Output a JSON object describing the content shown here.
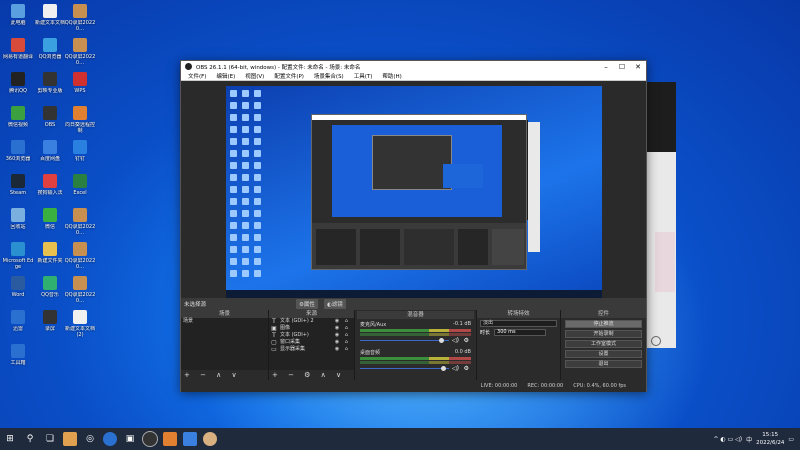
{
  "desktop": {
    "icons": [
      {
        "label": "此电脑",
        "color": "#5aa0e0"
      },
      {
        "label": "新建文本文档",
        "color": "#f0f0f0"
      },
      {
        "label": "QQ录屏20220…",
        "color": "#c89050"
      },
      {
        "label": "网易有道翻译",
        "color": "#d84a3a"
      },
      {
        "label": "QQ浏览器",
        "color": "#3aa0e0"
      },
      {
        "label": "QQ录屏20220…",
        "color": "#c89050"
      },
      {
        "label": "腾讯QQ",
        "color": "#222"
      },
      {
        "label": "剪映专业版",
        "color": "#333"
      },
      {
        "label": "WPS",
        "color": "#d03030"
      },
      {
        "label": "微信视频",
        "color": "#3aa040"
      },
      {
        "label": "OBS",
        "color": "#333"
      },
      {
        "label": "向日葵远程控制",
        "color": "#e08030"
      },
      {
        "label": "360浏览器",
        "color": "#2a70d0"
      },
      {
        "label": "百度网盘",
        "color": "#3a80e0"
      },
      {
        "label": "钉钉",
        "color": "#2a80e0"
      },
      {
        "label": "Steam",
        "color": "#1b2838"
      },
      {
        "label": "搜狗输入法",
        "color": "#e04040"
      },
      {
        "label": "Excel",
        "color": "#2a8040"
      },
      {
        "label": "回收站",
        "color": "#7ab0e0"
      },
      {
        "label": "微信",
        "color": "#3ab040"
      },
      {
        "label": "QQ录屏20220…",
        "color": "#c89050"
      },
      {
        "label": "Microsoft Edge",
        "color": "#2a90d0"
      },
      {
        "label": "新建文件夹",
        "color": "#e8c050"
      },
      {
        "label": "QQ录屏20220…",
        "color": "#c89050"
      },
      {
        "label": "Word",
        "color": "#2a5aa0"
      },
      {
        "label": "QQ音乐",
        "color": "#30b070"
      },
      {
        "label": "QQ录屏20220…",
        "color": "#c89050"
      },
      {
        "label": "迅雷",
        "color": "#2a70d0"
      },
      {
        "label": "录屏",
        "color": "#333"
      },
      {
        "label": "新建文本文档(2)",
        "color": "#f0f0f0"
      },
      {
        "label": "工具箱",
        "color": "#2a70d0"
      }
    ]
  },
  "obs": {
    "title": "OBS 26.1.1 (64-bit, windows) - 配置文件: 未命名 - 场景: 未命名",
    "window_buttons": [
      "–",
      "☐",
      "✕"
    ],
    "menu": [
      "文件(F)",
      "编辑(E)",
      "视图(V)",
      "配置文件(P)",
      "场景集合(S)",
      "工具(T)",
      "帮助(H)"
    ],
    "toolbar": {
      "no_source": "未选择源",
      "props": "⚙属性",
      "filters": "◐滤镜"
    },
    "docks": {
      "scenes": {
        "header": "场景",
        "items": [
          "场景"
        ],
        "footer": "+ − ∧ ∨"
      },
      "sources": {
        "header": "来源",
        "items": [
          {
            "icon": "T",
            "label": "文本 (GDI+) 2"
          },
          {
            "icon": "▣",
            "label": "图像"
          },
          {
            "icon": "T",
            "label": "文本 (GDI+)"
          },
          {
            "icon": "▢",
            "label": "窗口采集"
          },
          {
            "icon": "▭",
            "label": "显示器采集"
          }
        ],
        "footer": "+ − ⚙ ∧ ∨"
      },
      "mixer": {
        "header": "混音器",
        "channels": [
          {
            "name": "麦克风/Aux",
            "db": "-0.1 dB",
            "level": 0.86
          },
          {
            "name": "桌面音频",
            "db": "0.0 dB",
            "level": 0.88
          }
        ]
      },
      "transitions": {
        "header": "转场特效",
        "type": "淡出",
        "duration_label": "时长",
        "duration_value": "300 ms"
      },
      "controls": {
        "header": "控件",
        "buttons": [
          "停止推流",
          "开始录制",
          "工作室模式",
          "设置",
          "退出"
        ]
      }
    },
    "status": {
      "live": "LIVE: 00:00:00",
      "rec": "REC: 00:00:00",
      "cpu": "CPU: 0.4%, 60.00 fps"
    }
  },
  "taskbar": {
    "time": "15:15",
    "date": "2022/6/24",
    "ime": "中",
    "tray": "^ ◐ ▭ ◁)"
  }
}
